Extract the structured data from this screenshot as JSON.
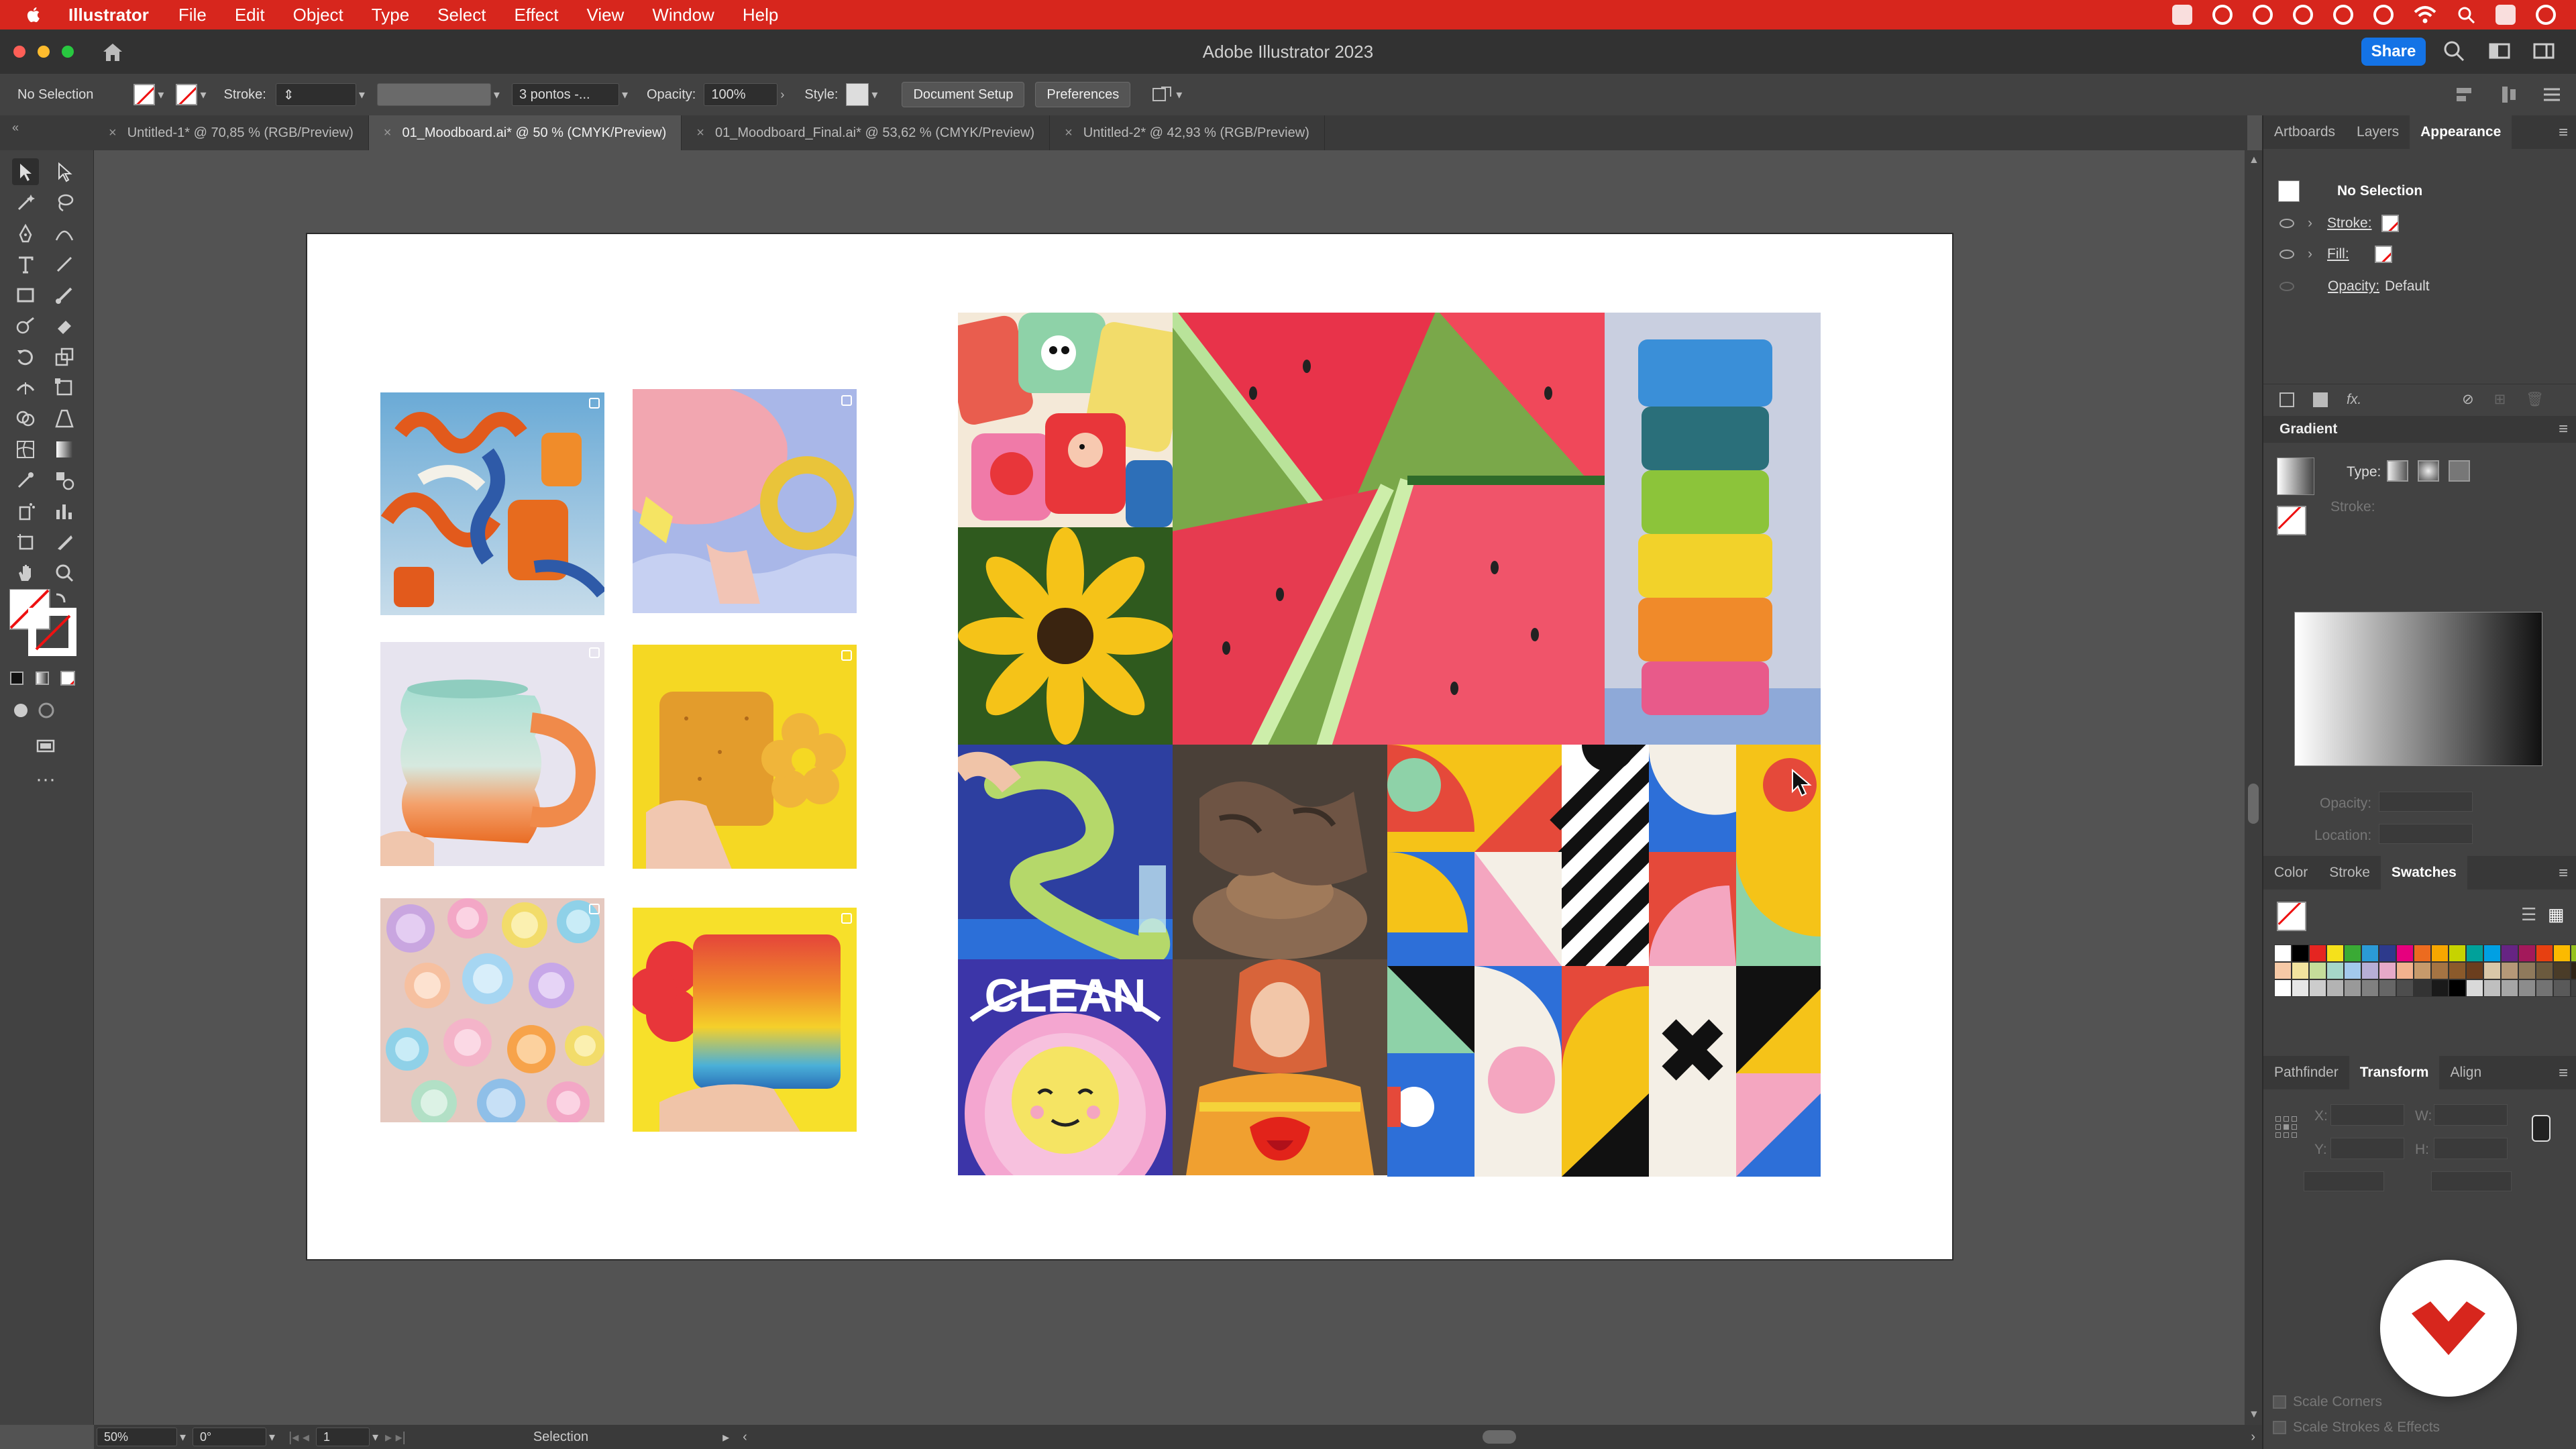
{
  "menubar": {
    "app_name": "Illustrator",
    "items": [
      "File",
      "Edit",
      "Object",
      "Type",
      "Select",
      "Effect",
      "View",
      "Window",
      "Help"
    ]
  },
  "window": {
    "title": "Adobe Illustrator 2023",
    "share_label": "Share"
  },
  "control_bar": {
    "selection_label": "No Selection",
    "stroke_label": "Stroke:",
    "brush_value": "3 pontos -...",
    "opacity_label": "Opacity:",
    "opacity_value": "100%",
    "style_label": "Style:",
    "document_setup_label": "Document Setup",
    "preferences_label": "Preferences"
  },
  "tabs": [
    {
      "label": "Untitled-1* @ 70,85 % (RGB/Preview)",
      "active": false
    },
    {
      "label": "01_Moodboard.ai* @ 50 % (CMYK/Preview)",
      "active": true
    },
    {
      "label": "01_Moodboard_Final.ai* @ 53,62 % (CMYK/Preview)",
      "active": false
    },
    {
      "label": "Untitled-2* @ 42,93 % (RGB/Preview)",
      "active": false
    }
  ],
  "appearance_panel": {
    "tabs": [
      "Artboards",
      "Layers",
      "Appearance"
    ],
    "active_tab": "Appearance",
    "header": "No Selection",
    "stroke_label": "Stroke:",
    "fill_label": "Fill:",
    "opacity_label": "Opacity:",
    "opacity_value": "Default"
  },
  "gradient_panel": {
    "title": "Gradient",
    "type_label": "Type:",
    "stroke_label": "Stroke:",
    "opacity_label": "Opacity:",
    "location_label": "Location:"
  },
  "swatches_panel": {
    "tabs": [
      "Color",
      "Stroke",
      "Swatches"
    ],
    "active_tab": "Swatches",
    "colors": [
      "#ffffff",
      "#000000",
      "#e52521",
      "#f5e11b",
      "#3aaa35",
      "#2b9ad6",
      "#2d3a8c",
      "#e6007e",
      "#ec6b1f",
      "#f7a600",
      "#c6d300",
      "#00a19a",
      "#00a0e3",
      "#662483",
      "#a3195b",
      "#e74011",
      "#fbba00",
      "#95c11f",
      "#f6c9a6",
      "#f2e39e",
      "#c5dd9a",
      "#a6d6c9",
      "#a3c9ec",
      "#b7aed6",
      "#e6a9c8",
      "#f2b28e",
      "#c79a6b",
      "#a57443",
      "#8b5a2b",
      "#6b3e1e",
      "#d9c7a8",
      "#b59878",
      "#8f7a5c",
      "#6b5a3e",
      "#4a3c28",
      "#2e2418",
      "#ffffff",
      "#e6e6e6",
      "#cccccc",
      "#b3b3b3",
      "#999999",
      "#808080",
      "#666666",
      "#4d4d4d",
      "#333333",
      "#1a1a1a",
      "#000000",
      "#d9d9d9",
      "#bfbfbf",
      "#a6a6a6",
      "#8c8c8c",
      "#737373",
      "#595959",
      "#404040"
    ]
  },
  "transform_panel": {
    "tabs": [
      "Pathfinder",
      "Transform",
      "Align"
    ],
    "active_tab": "Transform",
    "x_label": "X:",
    "y_label": "Y:",
    "w_label": "W:",
    "h_label": "H:",
    "scale_corners": "Scale Corners",
    "scale_strokes": "Scale Strokes & Effects"
  },
  "status_bar": {
    "zoom": "50%",
    "rotation": "0°",
    "artboard_number": "1",
    "tool_name": "Selection"
  }
}
